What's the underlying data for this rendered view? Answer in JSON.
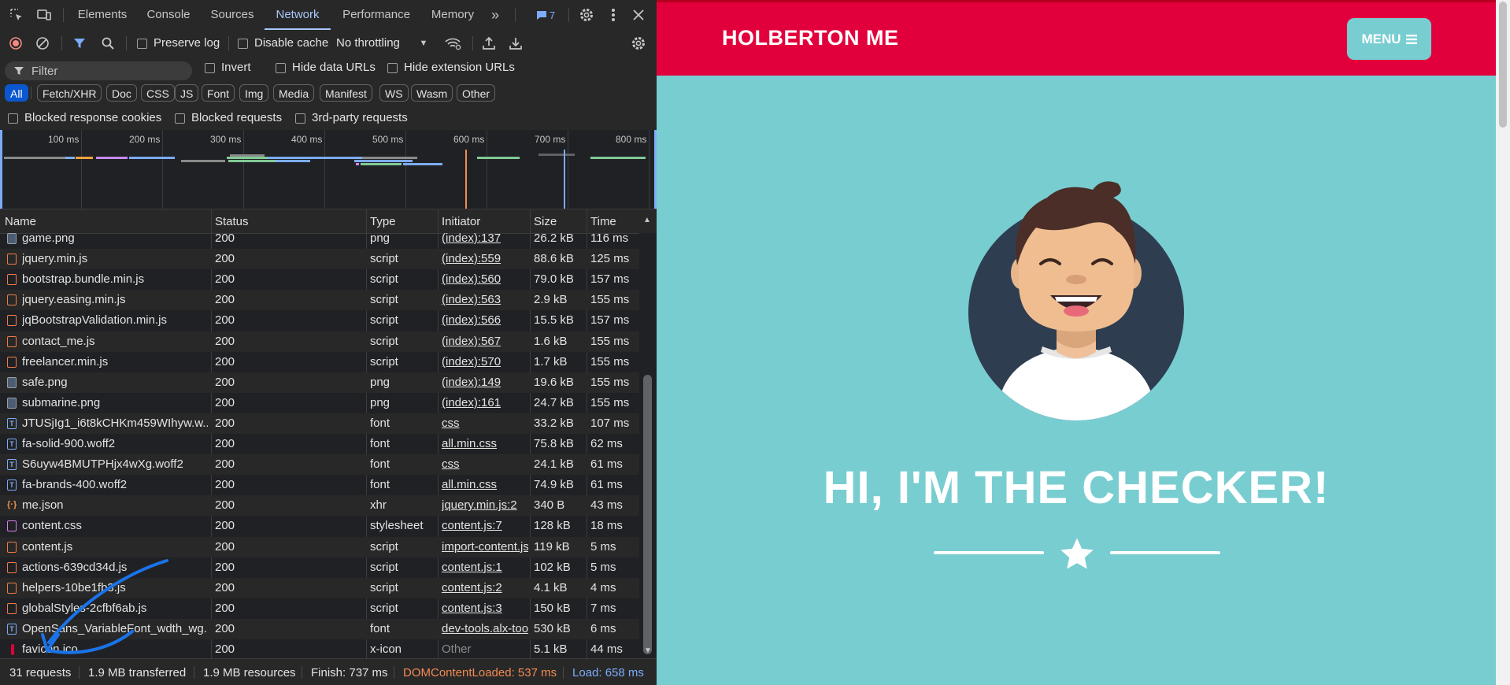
{
  "devtools": {
    "tabs": [
      "Elements",
      "Console",
      "Sources",
      "Network",
      "Performance",
      "Memory"
    ],
    "active_tab": "Network",
    "issues_count": "7",
    "toolbar": {
      "preserve_log": "Preserve log",
      "disable_cache": "Disable cache",
      "throttling": "No throttling"
    },
    "filter": {
      "placeholder": "Filter",
      "invert": "Invert",
      "hide_data_urls": "Hide data URLs",
      "hide_extension_urls": "Hide extension URLs",
      "types": [
        "All",
        "Fetch/XHR",
        "Doc",
        "CSS",
        "JS",
        "Font",
        "Img",
        "Media",
        "Manifest",
        "WS",
        "Wasm",
        "Other"
      ],
      "active_type": "All",
      "blocked_response_cookies": "Blocked response cookies",
      "blocked_requests": "Blocked requests",
      "third_party": "3rd-party requests"
    },
    "overview_ticks": [
      "100 ms",
      "200 ms",
      "300 ms",
      "400 ms",
      "500 ms",
      "600 ms",
      "700 ms",
      "800 ms"
    ],
    "columns": [
      "Name",
      "Status",
      "Type",
      "Initiator",
      "Size",
      "Time"
    ],
    "rows": [
      {
        "icon": "img",
        "name": "game.png",
        "status": "200",
        "type": "png",
        "initiator": "(index):137",
        "size": "26.2 kB",
        "time": "116 ms"
      },
      {
        "icon": "js",
        "name": "jquery.min.js",
        "status": "200",
        "type": "script",
        "initiator": "(index):559",
        "size": "88.6 kB",
        "time": "125 ms"
      },
      {
        "icon": "js",
        "name": "bootstrap.bundle.min.js",
        "status": "200",
        "type": "script",
        "initiator": "(index):560",
        "size": "79.0 kB",
        "time": "157 ms"
      },
      {
        "icon": "js",
        "name": "jquery.easing.min.js",
        "status": "200",
        "type": "script",
        "initiator": "(index):563",
        "size": "2.9 kB",
        "time": "155 ms"
      },
      {
        "icon": "js",
        "name": "jqBootstrapValidation.min.js",
        "status": "200",
        "type": "script",
        "initiator": "(index):566",
        "size": "15.5 kB",
        "time": "157 ms"
      },
      {
        "icon": "js",
        "name": "contact_me.js",
        "status": "200",
        "type": "script",
        "initiator": "(index):567",
        "size": "1.6 kB",
        "time": "155 ms"
      },
      {
        "icon": "js",
        "name": "freelancer.min.js",
        "status": "200",
        "type": "script",
        "initiator": "(index):570",
        "size": "1.7 kB",
        "time": "155 ms"
      },
      {
        "icon": "img",
        "name": "safe.png",
        "status": "200",
        "type": "png",
        "initiator": "(index):149",
        "size": "19.6 kB",
        "time": "155 ms"
      },
      {
        "icon": "img",
        "name": "submarine.png",
        "status": "200",
        "type": "png",
        "initiator": "(index):161",
        "size": "24.7 kB",
        "time": "155 ms"
      },
      {
        "icon": "font",
        "name": "JTUSjIg1_i6t8kCHKm459WIhyw.w...",
        "status": "200",
        "type": "font",
        "initiator": "css",
        "size": "33.2 kB",
        "time": "107 ms"
      },
      {
        "icon": "font",
        "name": "fa-solid-900.woff2",
        "status": "200",
        "type": "font",
        "initiator": "all.min.css",
        "size": "75.8 kB",
        "time": "62 ms"
      },
      {
        "icon": "font",
        "name": "S6uyw4BMUTPHjx4wXg.woff2",
        "status": "200",
        "type": "font",
        "initiator": "css",
        "size": "24.1 kB",
        "time": "61 ms"
      },
      {
        "icon": "font",
        "name": "fa-brands-400.woff2",
        "status": "200",
        "type": "font",
        "initiator": "all.min.css",
        "size": "74.9 kB",
        "time": "61 ms"
      },
      {
        "icon": "json",
        "name": "me.json",
        "status": "200",
        "type": "xhr",
        "initiator": "jquery.min.js:2",
        "size": "340 B",
        "time": "43 ms"
      },
      {
        "icon": "css",
        "name": "content.css",
        "status": "200",
        "type": "stylesheet",
        "initiator": "content.js:7",
        "size": "128 kB",
        "time": "18 ms"
      },
      {
        "icon": "js",
        "name": "content.js",
        "status": "200",
        "type": "script",
        "initiator": "import-content.js",
        "size": "119 kB",
        "time": "5 ms"
      },
      {
        "icon": "js",
        "name": "actions-639cd34d.js",
        "status": "200",
        "type": "script",
        "initiator": "content.js:1",
        "size": "102 kB",
        "time": "5 ms"
      },
      {
        "icon": "js",
        "name": "helpers-10be1fb3.js",
        "status": "200",
        "type": "script",
        "initiator": "content.js:2",
        "size": "4.1 kB",
        "time": "4 ms"
      },
      {
        "icon": "js",
        "name": "globalStyles-2cfbf6ab.js",
        "status": "200",
        "type": "script",
        "initiator": "content.js:3",
        "size": "150 kB",
        "time": "7 ms"
      },
      {
        "icon": "font",
        "name": "OpenSans_VariableFont_wdth_wg...",
        "status": "200",
        "type": "font",
        "initiator": "dev-tools.alx-tools",
        "size": "530 kB",
        "time": "6 ms"
      },
      {
        "icon": "ico",
        "name": "favicon.ico",
        "status": "200",
        "type": "x-icon",
        "initiator": "Other",
        "size": "5.1 kB",
        "time": "44 ms"
      }
    ],
    "summary": {
      "requests": "31 requests",
      "transferred": "1.9 MB transferred",
      "resources": "1.9 MB resources",
      "finish": "Finish: 737 ms",
      "dcl": "DOMContentLoaded: 537 ms",
      "load": "Load: 658 ms"
    },
    "colors": {
      "dcl": "#f28b54",
      "load": "#7cacf8",
      "accent": "#a8c7fa"
    }
  },
  "page": {
    "brand": "HOLBERTON ME",
    "menu_label": "MENU",
    "headline": "HI, I'M THE CHECKER!",
    "colors": {
      "nav": "#e2003c",
      "background": "#78cdd1"
    }
  }
}
